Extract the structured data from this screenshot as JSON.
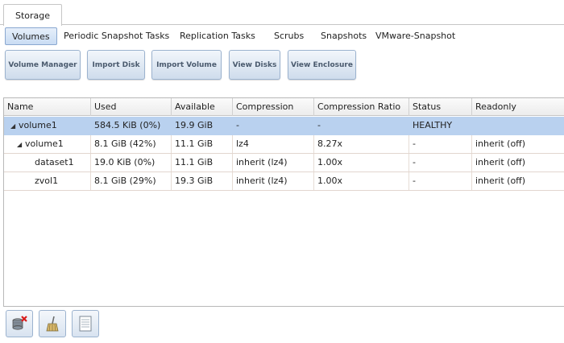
{
  "top_tabs": [
    {
      "label": "Storage"
    }
  ],
  "sub_tabs": [
    {
      "label": "Volumes"
    },
    {
      "label": "Periodic Snapshot Tasks"
    },
    {
      "label": "Replication Tasks"
    },
    {
      "label": "Scrubs"
    },
    {
      "label": "Snapshots"
    },
    {
      "label": "VMware-Snapshot"
    }
  ],
  "toolbar": [
    {
      "label": "Volume Manager"
    },
    {
      "label": "Import Disk"
    },
    {
      "label": "Import Volume"
    },
    {
      "label": "View Disks"
    },
    {
      "label": "View Enclosure"
    }
  ],
  "table": {
    "columns": [
      "Name",
      "Used",
      "Available",
      "Compression",
      "Compression Ratio",
      "Status",
      "Readonly"
    ],
    "rows": [
      {
        "name": "volume1",
        "used": "584.5 KiB (0%)",
        "available": "19.9 GiB",
        "compression": "-",
        "ratio": "-",
        "status": "HEALTHY",
        "readonly": ""
      },
      {
        "name": "volume1",
        "used": "8.1 GiB (42%)",
        "available": "11.1 GiB",
        "compression": "lz4",
        "ratio": "8.27x",
        "status": "-",
        "readonly": "inherit (off)"
      },
      {
        "name": "dataset1",
        "used": "19.0 KiB (0%)",
        "available": "11.1 GiB",
        "compression": "inherit (lz4)",
        "ratio": "1.00x",
        "status": "-",
        "readonly": "inherit (off)"
      },
      {
        "name": "zvol1",
        "used": "8.1 GiB (29%)",
        "available": "19.3 GiB",
        "compression": "inherit (lz4)",
        "ratio": "1.00x",
        "status": "-",
        "readonly": "inherit (off)"
      }
    ]
  },
  "bottom_buttons": [
    {
      "icon": "detach-volume-icon"
    },
    {
      "icon": "scrub-broom-icon"
    },
    {
      "icon": "volume-status-icon"
    }
  ],
  "colors": {
    "selected_row": "#b9d1ef",
    "accent": "#9cb3cf"
  }
}
